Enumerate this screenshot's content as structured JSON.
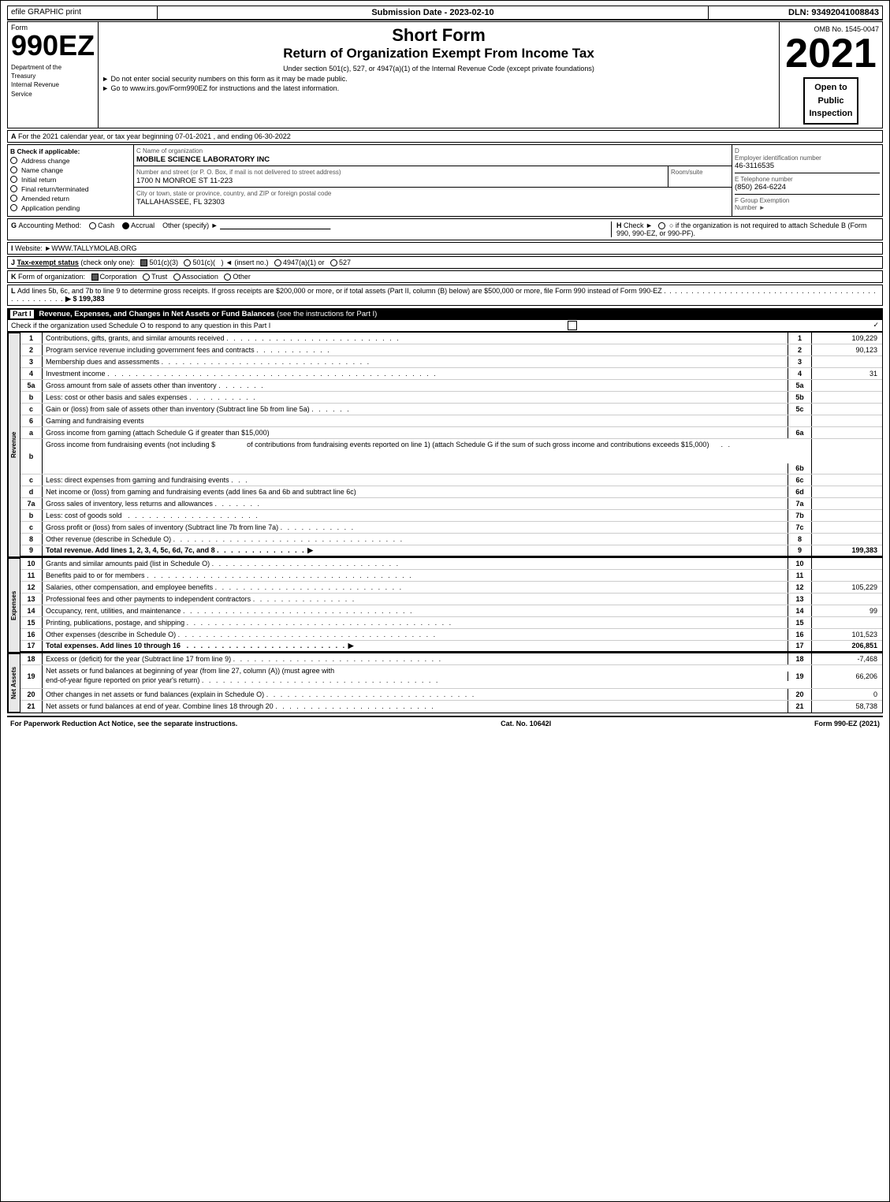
{
  "header": {
    "efile": "efile GRAPHIC print",
    "submission_label": "Submission Date - 2023-02-10",
    "dln": "DLN: 93492041008843",
    "form_label": "Form",
    "form_number": "990EZ",
    "dept_line1": "Department of the",
    "dept_line2": "Treasury",
    "dept_line3": "Internal Revenue",
    "dept_line4": "Service",
    "short_form": "Short Form",
    "return_title": "Return of Organization Exempt From Income Tax",
    "subtitle": "Under section 501(c), 527, or 4947(a)(1) of the Internal Revenue Code (except private foundations)",
    "instruction1": "► Do not enter social security numbers on this form as it may be made public.",
    "instruction2": "► Go to www.irs.gov/Form990EZ for instructions and the latest information.",
    "omb": "OMB No. 1545-0047",
    "year": "2021",
    "open_to": "Open to",
    "public": "Public",
    "inspection": "Inspection"
  },
  "section_a": {
    "label": "A",
    "text": "For the 2021 calendar year, or tax year beginning 07-01-2021 , and ending 06-30-2022"
  },
  "section_b": {
    "label": "B",
    "title": "Check if applicable:",
    "checks": [
      {
        "label": "Address change",
        "checked": false
      },
      {
        "label": "Name change",
        "checked": false
      },
      {
        "label": "Initial return",
        "checked": false
      },
      {
        "label": "Final return/terminated",
        "checked": false
      },
      {
        "label": "Amended return",
        "checked": false
      },
      {
        "label": "Application pending",
        "checked": false
      }
    ]
  },
  "section_c": {
    "label": "C",
    "title": "Name of organization",
    "org_name": "MOBILE SCIENCE LABORATORY INC",
    "address_label": "Number and street (or P. O. Box, if mail is not delivered to street address)",
    "address": "1700 N MONROE ST 11-223",
    "room_label": "Room/suite",
    "room": "",
    "city_label": "City or town, state or province, country, and ZIP or foreign postal code",
    "city": "TALLAHASSEE, FL  32303"
  },
  "section_d": {
    "label": "D",
    "title": "Employer identification number",
    "ein": "46-3116535",
    "e_label": "E Telephone number",
    "phone": "(850) 264-6224",
    "f_label": "F Group Exemption",
    "f_label2": "Number",
    "f_arrow": "►"
  },
  "section_g": {
    "label": "G",
    "text": "Accounting Method:",
    "cash": "Cash",
    "accrual": "Accrual",
    "accrual_checked": true,
    "other": "Other (specify) ►",
    "underline": "____________________________"
  },
  "section_h": {
    "label": "H",
    "text": "Check ►",
    "option": "○ if the organization is not required to attach Schedule B (Form 990, 990-EZ, or 990-PF)."
  },
  "section_i": {
    "label": "I",
    "text": "Website: ►WWW.TALLYMOLAB.ORG"
  },
  "section_j": {
    "label": "J",
    "text": "Tax-exempt status",
    "note": "(check only one):",
    "options": [
      {
        "label": "501(c)(3)",
        "checked": true
      },
      {
        "label": "501(c)(",
        "checked": false
      },
      {
        "label": ") ◄ (insert no.)",
        "checked": false
      },
      {
        "label": "4947(a)(1) or",
        "checked": false
      },
      {
        "label": "527",
        "checked": false
      }
    ]
  },
  "section_k": {
    "label": "K",
    "text": "Form of organization:",
    "options": [
      {
        "label": "Corporation",
        "checked": true
      },
      {
        "label": "Trust",
        "checked": false
      },
      {
        "label": "Association",
        "checked": false
      },
      {
        "label": "Other",
        "checked": false
      }
    ]
  },
  "section_l": {
    "label": "L",
    "text": "Add lines 5b, 6c, and 7b to line 9 to determine gross receipts. If gross receipts are $200,000 or more, or if total assets (Part II, column (B) below) are $500,000 or more, file Form 990 instead of Form 990-EZ",
    "dots": ". . . . . . . . . . . . . . . . . . . . . . . . . . . . . . . . . . . . . . . . . . . . . . . . .",
    "arrow": "►$",
    "amount": "199,383"
  },
  "part1": {
    "title": "Part I",
    "description": "Revenue, Expenses, and Changes in Net Assets or Fund Balances",
    "see_instructions": "(see the instructions for Part I)",
    "check_text": "Check if the organization used Schedule O to respond to any question in this Part I",
    "lines": [
      {
        "num": "1",
        "desc": "Contributions, gifts, grants, and similar amounts received",
        "dots": true,
        "amount": "109,229"
      },
      {
        "num": "2",
        "desc": "Program service revenue including government fees and contracts",
        "dots": true,
        "amount": "90,123"
      },
      {
        "num": "3",
        "desc": "Membership dues and assessments",
        "dots": true,
        "amount": ""
      },
      {
        "num": "4",
        "desc": "Investment income",
        "dots": true,
        "amount": "31"
      },
      {
        "num": "5a",
        "desc": "Gross amount from sale of assets other than inventory",
        "sub": "5a",
        "amount": ""
      },
      {
        "num": "5b",
        "desc": "Less: cost or other basis and sales expenses",
        "sub": "5b",
        "amount": ""
      },
      {
        "num": "5c",
        "desc": "Gain or (loss) from sale of assets other than inventory (Subtract line 5b from line 5a)",
        "dots": true,
        "linenum": "5c",
        "amount": ""
      },
      {
        "num": "6",
        "desc": "Gaming and fundraising events",
        "amount": ""
      },
      {
        "num": "6a",
        "sub": "6a",
        "desc": "Gross income from gaming (attach Schedule G if greater than $15,000)",
        "amount": ""
      },
      {
        "num": "6b",
        "desc": "Gross income from fundraising events (not including $",
        "underline": "_______________",
        "desc2": "of contributions from fundraising events reported on line 1) (attach Schedule G if the sum of such gross income and contributions exceeds $15,000)",
        "sub": "6b",
        "amount": ""
      },
      {
        "num": "6c",
        "desc": "Less: direct expenses from gaming and fundraising events",
        "sub": "6c",
        "amount": ""
      },
      {
        "num": "6d",
        "desc": "Net income or (loss) from gaming and fundraising events (add lines 6a and 6b and subtract line 6c)",
        "linenum": "6d",
        "amount": ""
      },
      {
        "num": "7a",
        "desc": "Gross sales of inventory, less returns and allowances",
        "sub": "7a",
        "dots": true,
        "amount": ""
      },
      {
        "num": "7b",
        "desc": "Less: cost of goods sold",
        "dots": true,
        "sub": "7b",
        "amount": ""
      },
      {
        "num": "7c",
        "desc": "Gross profit or (loss) from sales of inventory (Subtract line 7b from line 7a)",
        "dots": true,
        "linenum": "7c",
        "amount": ""
      },
      {
        "num": "8",
        "desc": "Other revenue (describe in Schedule O)",
        "dots": true,
        "linenum": "8",
        "amount": ""
      },
      {
        "num": "9",
        "desc": "Total revenue. Add lines 1, 2, 3, 4, 5c, 6d, 7c, and 8",
        "dots": true,
        "arrow": true,
        "linenum": "9",
        "amount": "199,383",
        "bold": true
      }
    ]
  },
  "expenses_lines": [
    {
      "num": "10",
      "desc": "Grants and similar amounts paid (list in Schedule O)",
      "dots": true,
      "amount": ""
    },
    {
      "num": "11",
      "desc": "Benefits paid to or for members",
      "dots": true,
      "amount": ""
    },
    {
      "num": "12",
      "desc": "Salaries, other compensation, and employee benefits",
      "dots": true,
      "amount": "105,229"
    },
    {
      "num": "13",
      "desc": "Professional fees and other payments to independent contractors",
      "dots": true,
      "amount": ""
    },
    {
      "num": "14",
      "desc": "Occupancy, rent, utilities, and maintenance",
      "dots": true,
      "amount": "99"
    },
    {
      "num": "15",
      "desc": "Printing, publications, postage, and shipping",
      "dots": true,
      "amount": ""
    },
    {
      "num": "16",
      "desc": "Other expenses (describe in Schedule O)",
      "dots": true,
      "amount": "101,523"
    },
    {
      "num": "17",
      "desc": "Total expenses. Add lines 10 through 16",
      "dots": true,
      "arrow": true,
      "amount": "206,851",
      "bold": true
    }
  ],
  "net_assets_lines": [
    {
      "num": "18",
      "desc": "Excess or (deficit) for the year (Subtract line 17 from line 9)",
      "dots": true,
      "amount": "-7,468"
    },
    {
      "num": "19",
      "desc": "Net assets or fund balances at beginning of year (from line 27, column (A)) (must agree with end-of-year figure reported on prior year's return)",
      "dots": true,
      "multiline": true,
      "amount": "66,206"
    },
    {
      "num": "20",
      "desc": "Other changes in net assets or fund balances (explain in Schedule O)",
      "dots": true,
      "amount": "0"
    },
    {
      "num": "21",
      "desc": "Net assets or fund balances at end of year. Combine lines 18 through 20",
      "dots": true,
      "amount": "58,738"
    }
  ],
  "footer": {
    "left": "For Paperwork Reduction Act Notice, see the separate instructions.",
    "cat": "Cat. No. 10642I",
    "right": "Form 990-EZ (2021)"
  }
}
